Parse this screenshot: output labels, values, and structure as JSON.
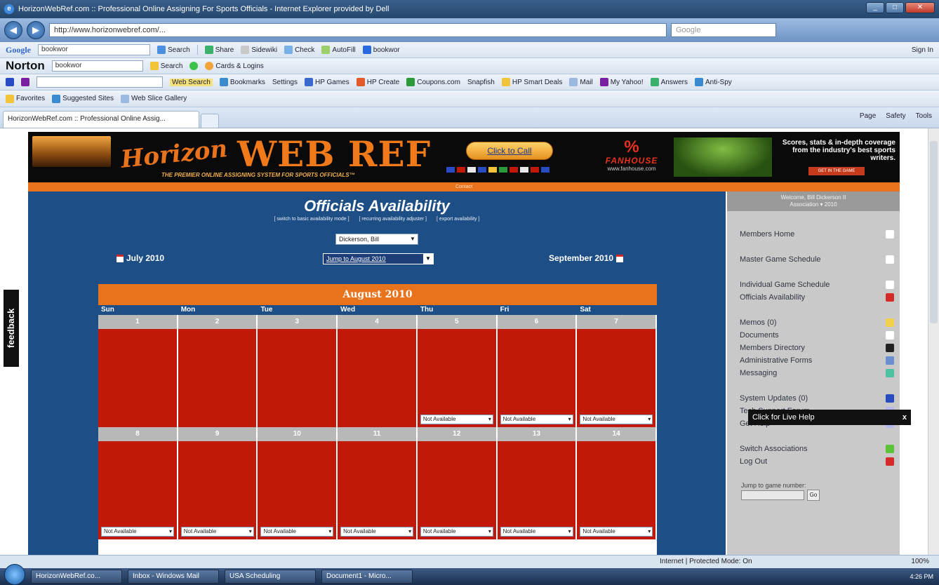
{
  "window": {
    "title": "HorizonWebRef.com :: Professional Online Assigning For Sports Officials - Internet Explorer provided by Dell",
    "url": "http://www.horizonwebref.com/...",
    "search_placeholder": "Google"
  },
  "toolbars": {
    "google": {
      "logo": "Google",
      "query": "bookwor",
      "search": "Search",
      "share": "Share",
      "sidewiki": "Sidewiki",
      "check": "Check",
      "autofill": "AutoFill",
      "term": "bookwor",
      "signin": "Sign In"
    },
    "norton": {
      "logo": "Norton",
      "query": "bookwor",
      "search": "Search",
      "cards": "Cards & Logins"
    },
    "yahoo": {
      "web_search": "Web Search",
      "bookmarks": "Bookmarks",
      "settings": "Settings",
      "games": "HP Games",
      "create": "HP Create",
      "coupons": "Coupons.com",
      "snapfish": "Snapfish",
      "deals": "HP Smart Deals",
      "mail": "Mail",
      "myyahoo": "My Yahoo!",
      "answers": "Answers",
      "antispy": "Anti-Spy"
    },
    "favorites": {
      "label": "Favorites",
      "suggested": "Suggested Sites",
      "webslice": "Web Slice Gallery"
    }
  },
  "tab": {
    "label": "HorizonWebRef.com :: Professional Online Assig..."
  },
  "commands": {
    "page": "Page",
    "safety": "Safety",
    "tools": "Tools"
  },
  "banner": {
    "logo_script": "Horizon",
    "logo_main": "WEB REF",
    "tagline": "THE PREMIER ONLINE ASSIGNING SYSTEM FOR SPORTS OFFICIALS™",
    "call": "Click to Call",
    "fanhouse_name": "FANHOUSE",
    "fanhouse_url": "www.fanhouse.com",
    "ad_text": "Scores, stats & in-depth coverage from the industry's best sports writers.",
    "ad_button": "GET IN THE GAME",
    "strip": "Contact"
  },
  "feedback": "feedback",
  "main": {
    "title": "Officials Availability",
    "links": [
      "[ switch to basic availability mode ]",
      "[ recurring availability adjuster ]",
      "[ export availability ]"
    ],
    "official_select": "Dickerson, Bill",
    "jump_select": "Jump to August 2010",
    "prev_month": "July 2010",
    "next_month": "September 2010"
  },
  "calendar": {
    "month": "August 2010",
    "days": [
      "Sun",
      "Mon",
      "Tue",
      "Wed",
      "Thu",
      "Fri",
      "Sat"
    ],
    "weeks": [
      {
        "nums": [
          "1",
          "2",
          "3",
          "4",
          "5",
          "6",
          "7"
        ],
        "status": [
          "",
          "",
          "",
          "",
          "Not Available",
          "Not Available",
          "Not Available"
        ]
      },
      {
        "nums": [
          "8",
          "9",
          "10",
          "11",
          "12",
          "13",
          "14"
        ],
        "status": [
          "Not Available",
          "Not Available",
          "Not Available",
          "Not Available",
          "Not Available",
          "Not Available",
          "Not Available"
        ]
      }
    ]
  },
  "sidebar": {
    "welcome_line1": "Welcome, Bill Dickerson II",
    "welcome_line2": "Association ▾ 2010",
    "items": [
      {
        "label": "Members Home",
        "icon": "home-icon",
        "color": "#ffffff",
        "gap_after": true
      },
      {
        "label": "Master Game Schedule",
        "icon": "schedule-icon",
        "color": "#ffffff",
        "gap_after": true
      },
      {
        "label": "Individual Game Schedule",
        "icon": "schedule-icon",
        "color": "#ffffff",
        "gap_after": false
      },
      {
        "label": "Officials Availability",
        "icon": "calendar-icon",
        "color": "#d42a2a",
        "gap_after": true
      },
      {
        "label": "Memos (0)",
        "icon": "memo-icon",
        "color": "#f2d04c",
        "gap_after": false
      },
      {
        "label": "Documents",
        "icon": "document-icon",
        "color": "#ffffff",
        "gap_after": false
      },
      {
        "label": "Members Directory",
        "icon": "phone-icon",
        "color": "#222222",
        "gap_after": false
      },
      {
        "label": "Administrative Forms",
        "icon": "forms-icon",
        "color": "#6a8fd0",
        "gap_after": false
      },
      {
        "label": "Messaging",
        "icon": "message-icon",
        "color": "#4cc2a0",
        "gap_after": true
      },
      {
        "label": "System Updates (0)",
        "icon": "updates-icon",
        "color": "#2a4cc2",
        "gap_after": false
      },
      {
        "label": "Tech Support Forum",
        "icon": "forum-icon",
        "color": "#b8b8f0",
        "gap_after": false
      },
      {
        "label": "Get Help",
        "icon": "help-icon",
        "color": "#b8b8f0",
        "gap_after": true
      },
      {
        "label": "Switch Associations",
        "icon": "switch-icon",
        "color": "#5cc23a",
        "gap_after": false
      },
      {
        "label": "Log Out",
        "icon": "logout-icon",
        "color": "#d42a2a",
        "gap_after": false
      }
    ],
    "jump_label": "Jump to game number:",
    "jump_go": "Go"
  },
  "livehelp": "Click for Live Help",
  "status": {
    "zone": "Internet | Protected Mode: On",
    "zoom": "100%"
  },
  "taskbar": {
    "tasks": [
      "HorizonWebRef.co...",
      "Inbox - Windows Mail",
      "USA Scheduling",
      "Document1 - Micro..."
    ],
    "clock": "4:26 PM"
  }
}
